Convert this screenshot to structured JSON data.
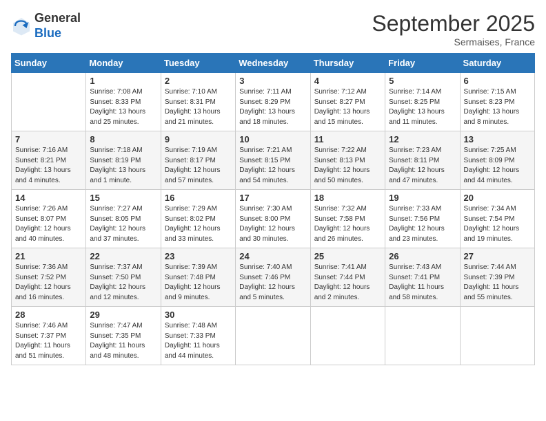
{
  "header": {
    "logo_general": "General",
    "logo_blue": "Blue",
    "month_title": "September 2025",
    "subtitle": "Sermaises, France"
  },
  "days_of_week": [
    "Sunday",
    "Monday",
    "Tuesday",
    "Wednesday",
    "Thursday",
    "Friday",
    "Saturday"
  ],
  "weeks": [
    [
      null,
      {
        "day": 1,
        "sunrise": "7:08 AM",
        "sunset": "8:33 PM",
        "daylight": "13 hours and 25 minutes."
      },
      {
        "day": 2,
        "sunrise": "7:10 AM",
        "sunset": "8:31 PM",
        "daylight": "13 hours and 21 minutes."
      },
      {
        "day": 3,
        "sunrise": "7:11 AM",
        "sunset": "8:29 PM",
        "daylight": "13 hours and 18 minutes."
      },
      {
        "day": 4,
        "sunrise": "7:12 AM",
        "sunset": "8:27 PM",
        "daylight": "13 hours and 15 minutes."
      },
      {
        "day": 5,
        "sunrise": "7:14 AM",
        "sunset": "8:25 PM",
        "daylight": "13 hours and 11 minutes."
      },
      {
        "day": 6,
        "sunrise": "7:15 AM",
        "sunset": "8:23 PM",
        "daylight": "13 hours and 8 minutes."
      }
    ],
    [
      {
        "day": 7,
        "sunrise": "7:16 AM",
        "sunset": "8:21 PM",
        "daylight": "13 hours and 4 minutes."
      },
      {
        "day": 8,
        "sunrise": "7:18 AM",
        "sunset": "8:19 PM",
        "daylight": "13 hours and 1 minute."
      },
      {
        "day": 9,
        "sunrise": "7:19 AM",
        "sunset": "8:17 PM",
        "daylight": "12 hours and 57 minutes."
      },
      {
        "day": 10,
        "sunrise": "7:21 AM",
        "sunset": "8:15 PM",
        "daylight": "12 hours and 54 minutes."
      },
      {
        "day": 11,
        "sunrise": "7:22 AM",
        "sunset": "8:13 PM",
        "daylight": "12 hours and 50 minutes."
      },
      {
        "day": 12,
        "sunrise": "7:23 AM",
        "sunset": "8:11 PM",
        "daylight": "12 hours and 47 minutes."
      },
      {
        "day": 13,
        "sunrise": "7:25 AM",
        "sunset": "8:09 PM",
        "daylight": "12 hours and 44 minutes."
      }
    ],
    [
      {
        "day": 14,
        "sunrise": "7:26 AM",
        "sunset": "8:07 PM",
        "daylight": "12 hours and 40 minutes."
      },
      {
        "day": 15,
        "sunrise": "7:27 AM",
        "sunset": "8:05 PM",
        "daylight": "12 hours and 37 minutes."
      },
      {
        "day": 16,
        "sunrise": "7:29 AM",
        "sunset": "8:02 PM",
        "daylight": "12 hours and 33 minutes."
      },
      {
        "day": 17,
        "sunrise": "7:30 AM",
        "sunset": "8:00 PM",
        "daylight": "12 hours and 30 minutes."
      },
      {
        "day": 18,
        "sunrise": "7:32 AM",
        "sunset": "7:58 PM",
        "daylight": "12 hours and 26 minutes."
      },
      {
        "day": 19,
        "sunrise": "7:33 AM",
        "sunset": "7:56 PM",
        "daylight": "12 hours and 23 minutes."
      },
      {
        "day": 20,
        "sunrise": "7:34 AM",
        "sunset": "7:54 PM",
        "daylight": "12 hours and 19 minutes."
      }
    ],
    [
      {
        "day": 21,
        "sunrise": "7:36 AM",
        "sunset": "7:52 PM",
        "daylight": "12 hours and 16 minutes."
      },
      {
        "day": 22,
        "sunrise": "7:37 AM",
        "sunset": "7:50 PM",
        "daylight": "12 hours and 12 minutes."
      },
      {
        "day": 23,
        "sunrise": "7:39 AM",
        "sunset": "7:48 PM",
        "daylight": "12 hours and 9 minutes."
      },
      {
        "day": 24,
        "sunrise": "7:40 AM",
        "sunset": "7:46 PM",
        "daylight": "12 hours and 5 minutes."
      },
      {
        "day": 25,
        "sunrise": "7:41 AM",
        "sunset": "7:44 PM",
        "daylight": "12 hours and 2 minutes."
      },
      {
        "day": 26,
        "sunrise": "7:43 AM",
        "sunset": "7:41 PM",
        "daylight": "11 hours and 58 minutes."
      },
      {
        "day": 27,
        "sunrise": "7:44 AM",
        "sunset": "7:39 PM",
        "daylight": "11 hours and 55 minutes."
      }
    ],
    [
      {
        "day": 28,
        "sunrise": "7:46 AM",
        "sunset": "7:37 PM",
        "daylight": "11 hours and 51 minutes."
      },
      {
        "day": 29,
        "sunrise": "7:47 AM",
        "sunset": "7:35 PM",
        "daylight": "11 hours and 48 minutes."
      },
      {
        "day": 30,
        "sunrise": "7:48 AM",
        "sunset": "7:33 PM",
        "daylight": "11 hours and 44 minutes."
      },
      null,
      null,
      null,
      null
    ]
  ]
}
